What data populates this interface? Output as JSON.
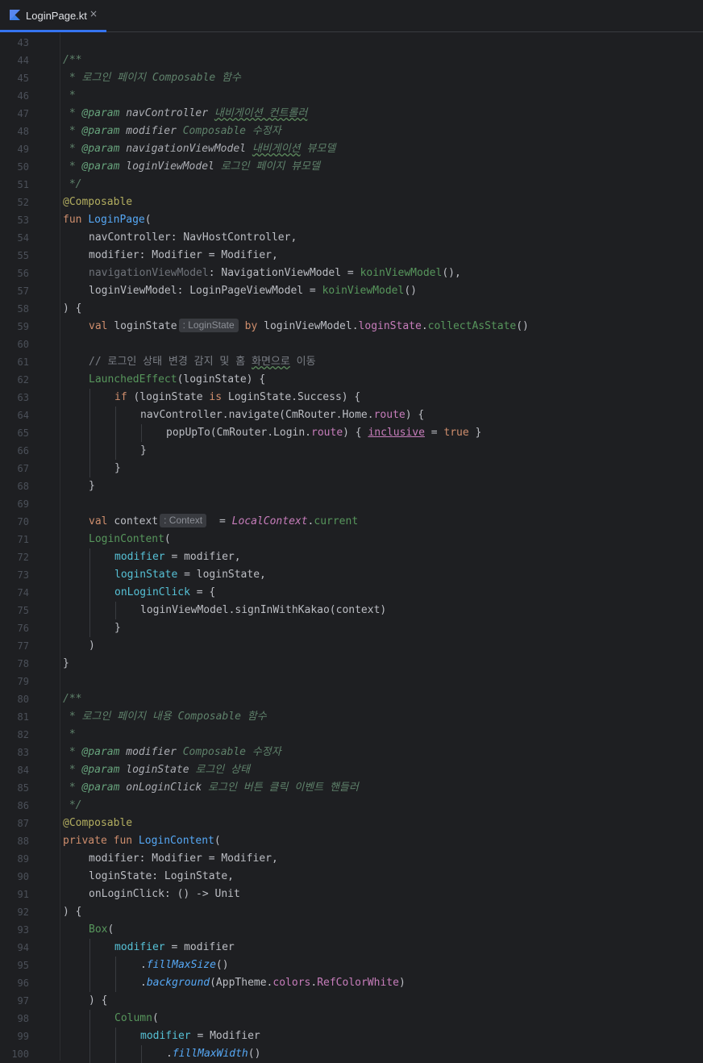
{
  "tab": {
    "title": "LoginPage.kt",
    "close_label": "×",
    "icon": "kotlin-file-icon",
    "active_color": "#3574f0"
  },
  "editor": {
    "background": "#1e1f22",
    "first_line": 43,
    "lines": [
      {
        "n": "43",
        "indent": 0,
        "seg": []
      },
      {
        "n": "44",
        "indent": 0,
        "seg": [
          [
            "doc",
            "/**"
          ]
        ]
      },
      {
        "n": "45",
        "indent": 0,
        "seg": [
          [
            "doc",
            " * 로그인 페이지 Composable 함수"
          ]
        ]
      },
      {
        "n": "46",
        "indent": 0,
        "seg": [
          [
            "doc",
            " *"
          ]
        ]
      },
      {
        "n": "47",
        "indent": 0,
        "seg": [
          [
            "doc",
            " * "
          ],
          [
            "doctag",
            "@param "
          ],
          [
            "docparam",
            "navController "
          ],
          [
            "doc typo",
            "내비게이션 컨트롤러"
          ]
        ]
      },
      {
        "n": "48",
        "indent": 0,
        "seg": [
          [
            "doc",
            " * "
          ],
          [
            "doctag",
            "@param "
          ],
          [
            "docparam",
            "modifier "
          ],
          [
            "doc",
            "Composable 수정자"
          ]
        ]
      },
      {
        "n": "49",
        "indent": 0,
        "seg": [
          [
            "doc",
            " * "
          ],
          [
            "doctag",
            "@param "
          ],
          [
            "docparam",
            "navigationViewModel "
          ],
          [
            "doc typo",
            "내비게이션"
          ],
          [
            "doc",
            " 뷰모델"
          ]
        ]
      },
      {
        "n": "50",
        "indent": 0,
        "seg": [
          [
            "doc",
            " * "
          ],
          [
            "doctag",
            "@param "
          ],
          [
            "docparam",
            "loginViewModel "
          ],
          [
            "doc",
            "로그인 페이지 뷰모델"
          ]
        ]
      },
      {
        "n": "51",
        "indent": 0,
        "seg": [
          [
            "doc",
            " */"
          ]
        ]
      },
      {
        "n": "52",
        "indent": 0,
        "seg": [
          [
            "ann",
            "@Composable"
          ]
        ]
      },
      {
        "n": "53",
        "indent": 0,
        "seg": [
          [
            "kw",
            "fun "
          ],
          [
            "fn",
            "LoginPage"
          ],
          [
            "",
            "("
          ]
        ]
      },
      {
        "n": "54",
        "indent": 1,
        "seg": [
          [
            "",
            "navController: NavHostController,"
          ]
        ]
      },
      {
        "n": "55",
        "indent": 1,
        "seg": [
          [
            "",
            "modifier: Modifier = Modifier,"
          ]
        ]
      },
      {
        "n": "56",
        "indent": 1,
        "seg": [
          [
            "grey",
            "navigationViewModel"
          ],
          [
            "",
            ": NavigationViewModel = "
          ],
          [
            "cmp",
            "koinViewModel"
          ],
          [
            "",
            "(),"
          ]
        ]
      },
      {
        "n": "57",
        "indent": 1,
        "seg": [
          [
            "",
            "loginViewModel: LoginPageViewModel = "
          ],
          [
            "cmp",
            "koinViewModel"
          ],
          [
            "",
            "()"
          ]
        ]
      },
      {
        "n": "58",
        "indent": 0,
        "seg": [
          [
            "",
            ") {"
          ]
        ]
      },
      {
        "n": "59",
        "indent": 1,
        "seg": [
          [
            "kw",
            "val "
          ],
          [
            "",
            "loginState"
          ],
          [
            "hint",
            ": LoginState"
          ],
          [
            "kw",
            "by "
          ],
          [
            "",
            "loginViewModel."
          ],
          [
            "prop",
            "loginState"
          ],
          [
            "",
            "."
          ],
          [
            "cmp",
            "collectAsState"
          ],
          [
            "",
            "()"
          ]
        ]
      },
      {
        "n": "60",
        "indent": 0,
        "seg": []
      },
      {
        "n": "61",
        "indent": 1,
        "seg": [
          [
            "cmt",
            "// 로그인 상태 변경 감지 및 홈 "
          ],
          [
            "cmt typo",
            "화면으로"
          ],
          [
            "cmt",
            " 이동"
          ]
        ]
      },
      {
        "n": "62",
        "indent": 1,
        "seg": [
          [
            "cmp",
            "LaunchedEffect"
          ],
          [
            "",
            "(loginState) {"
          ]
        ]
      },
      {
        "n": "63",
        "indent": 2,
        "seg": [
          [
            "kw",
            "if "
          ],
          [
            "",
            "(loginState "
          ],
          [
            "kw",
            "is "
          ],
          [
            "",
            "LoginState.Success) {"
          ]
        ]
      },
      {
        "n": "64",
        "indent": 3,
        "seg": [
          [
            "",
            "navController.navigate(CmRouter.Home."
          ],
          [
            "prop",
            "route"
          ],
          [
            "",
            ") {"
          ]
        ]
      },
      {
        "n": "65",
        "indent": 4,
        "seg": [
          [
            "",
            "popUpTo(CmRouter.Login."
          ],
          [
            "prop",
            "route"
          ],
          [
            "",
            ") { "
          ],
          [
            "prop uline",
            "inclusive"
          ],
          [
            "",
            " = "
          ],
          [
            "kw",
            "true"
          ],
          [
            "",
            " }"
          ]
        ]
      },
      {
        "n": "66",
        "indent": 3,
        "seg": [
          [
            "",
            "}"
          ]
        ]
      },
      {
        "n": "67",
        "indent": 2,
        "seg": [
          [
            "",
            "}"
          ]
        ]
      },
      {
        "n": "68",
        "indent": 1,
        "seg": [
          [
            "",
            "}"
          ]
        ]
      },
      {
        "n": "69",
        "indent": 0,
        "seg": []
      },
      {
        "n": "70",
        "indent": 1,
        "seg": [
          [
            "kw",
            "val "
          ],
          [
            "",
            "context"
          ],
          [
            "hint",
            ": Context"
          ],
          [
            "",
            " = "
          ],
          [
            "static",
            "LocalContext"
          ],
          [
            "",
            "."
          ],
          [
            "cmp",
            "current"
          ]
        ]
      },
      {
        "n": "71",
        "indent": 1,
        "seg": [
          [
            "cmp",
            "LoginContent"
          ],
          [
            "",
            "("
          ]
        ]
      },
      {
        "n": "72",
        "indent": 2,
        "seg": [
          [
            "named",
            "modifier"
          ],
          [
            "",
            " = modifier,"
          ]
        ]
      },
      {
        "n": "73",
        "indent": 2,
        "seg": [
          [
            "named",
            "loginState"
          ],
          [
            "",
            " = loginState,"
          ]
        ]
      },
      {
        "n": "74",
        "indent": 2,
        "seg": [
          [
            "named",
            "onLoginClick"
          ],
          [
            "",
            " = {"
          ]
        ]
      },
      {
        "n": "75",
        "indent": 3,
        "seg": [
          [
            "",
            "loginViewModel.signInWithKakao(context)"
          ]
        ]
      },
      {
        "n": "76",
        "indent": 2,
        "seg": [
          [
            "",
            "}"
          ]
        ]
      },
      {
        "n": "77",
        "indent": 1,
        "seg": [
          [
            "",
            ")"
          ]
        ]
      },
      {
        "n": "78",
        "indent": 0,
        "seg": [
          [
            "",
            "}"
          ]
        ]
      },
      {
        "n": "79",
        "indent": 0,
        "seg": []
      },
      {
        "n": "80",
        "indent": 0,
        "seg": [
          [
            "doc",
            "/**"
          ]
        ]
      },
      {
        "n": "81",
        "indent": 0,
        "seg": [
          [
            "doc",
            " * 로그인 페이지 내용 Composable 함수"
          ]
        ]
      },
      {
        "n": "82",
        "indent": 0,
        "seg": [
          [
            "doc",
            " *"
          ]
        ]
      },
      {
        "n": "83",
        "indent": 0,
        "seg": [
          [
            "doc",
            " * "
          ],
          [
            "doctag",
            "@param "
          ],
          [
            "docparam",
            "modifier "
          ],
          [
            "doc",
            "Composable 수정자"
          ]
        ]
      },
      {
        "n": "84",
        "indent": 0,
        "seg": [
          [
            "doc",
            " * "
          ],
          [
            "doctag",
            "@param "
          ],
          [
            "docparam",
            "loginState "
          ],
          [
            "doc",
            "로그인 상태"
          ]
        ]
      },
      {
        "n": "85",
        "indent": 0,
        "seg": [
          [
            "doc",
            " * "
          ],
          [
            "doctag",
            "@param "
          ],
          [
            "docparam",
            "onLoginClick "
          ],
          [
            "doc",
            "로그인 버튼 클릭 이벤트 핸들러"
          ]
        ]
      },
      {
        "n": "86",
        "indent": 0,
        "seg": [
          [
            "doc",
            " */"
          ]
        ]
      },
      {
        "n": "87",
        "indent": 0,
        "seg": [
          [
            "ann",
            "@Composable"
          ]
        ]
      },
      {
        "n": "88",
        "indent": 0,
        "seg": [
          [
            "kw",
            "private fun "
          ],
          [
            "fn",
            "LoginContent"
          ],
          [
            "",
            "("
          ]
        ]
      },
      {
        "n": "89",
        "indent": 1,
        "seg": [
          [
            "",
            "modifier: Modifier = Modifier,"
          ]
        ]
      },
      {
        "n": "90",
        "indent": 1,
        "seg": [
          [
            "",
            "loginState: LoginState,"
          ]
        ]
      },
      {
        "n": "91",
        "indent": 1,
        "seg": [
          [
            "",
            "onLoginClick: () -> Unit"
          ]
        ]
      },
      {
        "n": "92",
        "indent": 0,
        "seg": [
          [
            "",
            ") {"
          ]
        ]
      },
      {
        "n": "93",
        "indent": 1,
        "seg": [
          [
            "cmp",
            "Box"
          ],
          [
            "",
            "("
          ]
        ]
      },
      {
        "n": "94",
        "indent": 2,
        "seg": [
          [
            "named",
            "modifier"
          ],
          [
            "",
            " = modifier"
          ]
        ]
      },
      {
        "n": "95",
        "indent": 3,
        "seg": [
          [
            "",
            "."
          ],
          [
            "ext",
            "fillMaxSize"
          ],
          [
            "",
            "()"
          ]
        ]
      },
      {
        "n": "96",
        "indent": 3,
        "seg": [
          [
            "",
            "."
          ],
          [
            "ext",
            "background"
          ],
          [
            "",
            "(AppTheme."
          ],
          [
            "prop",
            "colors"
          ],
          [
            "",
            "."
          ],
          [
            "prop",
            "RefColorWhite"
          ],
          [
            "",
            ")"
          ]
        ]
      },
      {
        "n": "97",
        "indent": 1,
        "seg": [
          [
            "",
            ") {"
          ]
        ]
      },
      {
        "n": "98",
        "indent": 2,
        "seg": [
          [
            "cmp",
            "Column"
          ],
          [
            "",
            "("
          ]
        ]
      },
      {
        "n": "99",
        "indent": 3,
        "seg": [
          [
            "named",
            "modifier"
          ],
          [
            "",
            " = Modifier"
          ]
        ]
      },
      {
        "n": "100",
        "indent": 4,
        "seg": [
          [
            "",
            "."
          ],
          [
            "ext",
            "fillMaxWidth"
          ],
          [
            "",
            "()"
          ]
        ]
      }
    ]
  }
}
